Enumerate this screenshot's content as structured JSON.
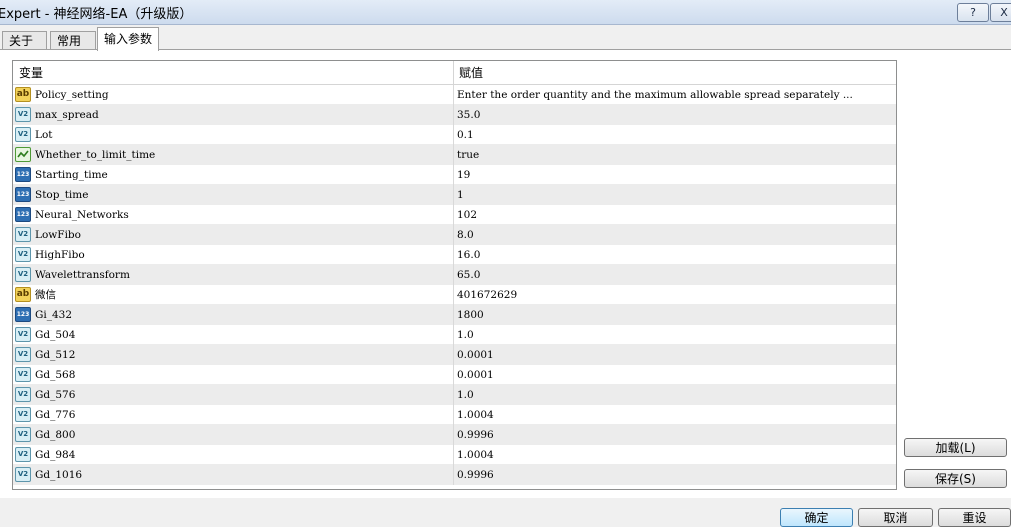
{
  "window": {
    "title": "Expert - 神经网络-EA（升级版）",
    "help_label": "?",
    "close_label": "X"
  },
  "tabs": [
    {
      "label": "关于"
    },
    {
      "label": "常用"
    },
    {
      "label": "输入参数",
      "active": true
    }
  ],
  "grid": {
    "headers": {
      "variable": "变量",
      "value": "赋值"
    },
    "rows": [
      {
        "icon": "ab",
        "name": "Policy_setting",
        "value": "Enter the order quantity and the maximum allowable spread separately ..."
      },
      {
        "icon": "double",
        "name": "max_spread",
        "value": "35.0"
      },
      {
        "icon": "double",
        "name": "Lot",
        "value": "0.1"
      },
      {
        "icon": "bool",
        "name": "Whether_to_limit_time",
        "value": "true"
      },
      {
        "icon": "int",
        "name": "Starting_time",
        "value": "19"
      },
      {
        "icon": "int",
        "name": "Stop_time",
        "value": "1"
      },
      {
        "icon": "int",
        "name": "Neural_Networks",
        "value": "102"
      },
      {
        "icon": "double",
        "name": "LowFibo",
        "value": "8.0"
      },
      {
        "icon": "double",
        "name": "HighFibo",
        "value": "16.0"
      },
      {
        "icon": "double",
        "name": "Wavelettransform",
        "value": "65.0"
      },
      {
        "icon": "ab",
        "name": "微信",
        "value": "401672629"
      },
      {
        "icon": "int",
        "name": "Gi_432",
        "value": "1800"
      },
      {
        "icon": "double",
        "name": "Gd_504",
        "value": "1.0"
      },
      {
        "icon": "double",
        "name": "Gd_512",
        "value": "0.0001"
      },
      {
        "icon": "double",
        "name": "Gd_568",
        "value": "0.0001"
      },
      {
        "icon": "double",
        "name": "Gd_576",
        "value": "1.0"
      },
      {
        "icon": "double",
        "name": "Gd_776",
        "value": "1.0004"
      },
      {
        "icon": "double",
        "name": "Gd_800",
        "value": "0.9996"
      },
      {
        "icon": "double",
        "name": "Gd_984",
        "value": "1.0004"
      },
      {
        "icon": "double",
        "name": "Gd_1016",
        "value": "0.9996"
      }
    ]
  },
  "icon_glyphs": {
    "ab": "ab",
    "double": "V2",
    "int": "123"
  },
  "buttons": {
    "load": "加载(L)",
    "save": "保存(S)",
    "ok": "确定",
    "cancel": "取消",
    "reset": "重设"
  }
}
